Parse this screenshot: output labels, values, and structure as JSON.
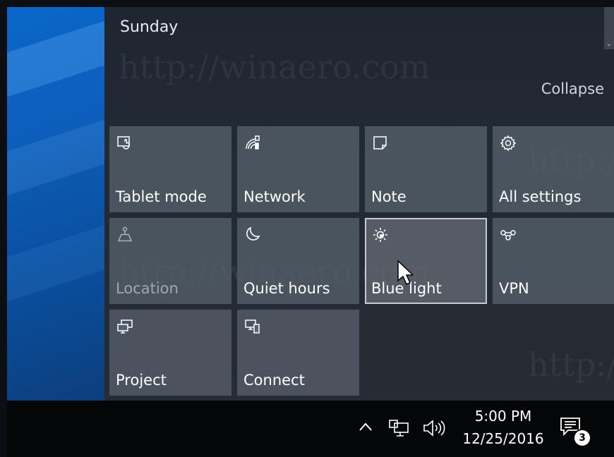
{
  "action_center": {
    "date_header": "Sunday",
    "collapse_label": "Collapse",
    "watermark": "http://winaero.com"
  },
  "quick_actions": [
    {
      "label": "Tablet mode",
      "icon": "tablet-mode-icon",
      "state": "off"
    },
    {
      "label": "Network",
      "icon": "network-icon",
      "state": "off"
    },
    {
      "label": "Note",
      "icon": "note-icon",
      "state": "off"
    },
    {
      "label": "All settings",
      "icon": "gear-icon",
      "state": "off"
    },
    {
      "label": "Location",
      "icon": "location-icon",
      "state": "disabled"
    },
    {
      "label": "Quiet hours",
      "icon": "moon-icon",
      "state": "off"
    },
    {
      "label": "Blue light",
      "icon": "brightness-icon",
      "state": "hover"
    },
    {
      "label": "VPN",
      "icon": "vpn-icon",
      "state": "off"
    },
    {
      "label": "Project",
      "icon": "project-icon",
      "state": "off"
    },
    {
      "label": "Connect",
      "icon": "connect-icon",
      "state": "off"
    }
  ],
  "taskbar": {
    "tray_icons": [
      "chevron-up-icon",
      "network-wired-icon",
      "volume-icon"
    ],
    "time": "5:00 PM",
    "date": "12/25/2016",
    "notification_count": "3"
  },
  "colors": {
    "tile": "#56606a",
    "panel": "#222a33",
    "taskbar": "#050607",
    "desktop": "#0a67c9"
  }
}
